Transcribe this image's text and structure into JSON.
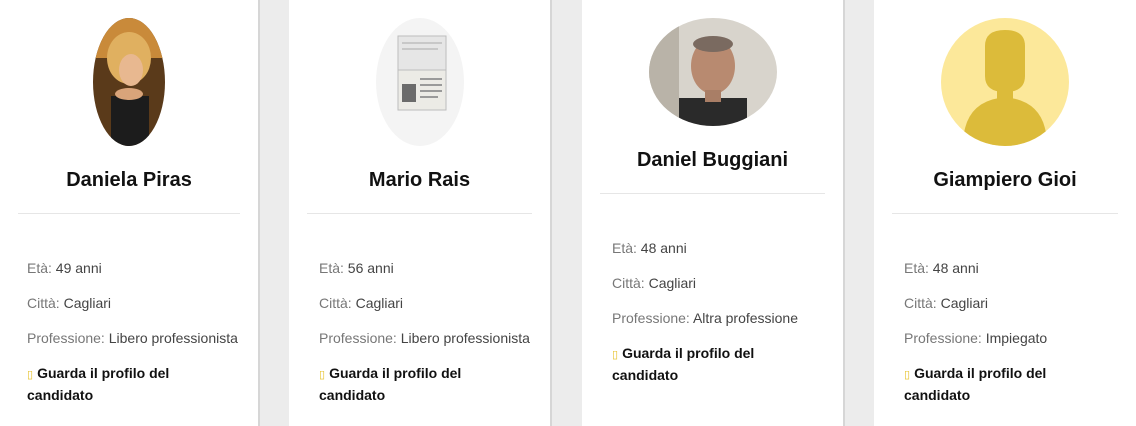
{
  "labels": {
    "age": "Età:",
    "city": "Città:",
    "profession": "Professione:",
    "link_arrow": "▯",
    "link_text": "Guarda il profilo del candidato"
  },
  "candidates": [
    {
      "name": "Daniela Piras",
      "age": "49 anni",
      "city": "Cagliari",
      "profession": "Libero professionista",
      "avatar_icon": "woman-photo"
    },
    {
      "name": "Mario Rais",
      "age": "56 anni",
      "city": "Cagliari",
      "profession": "Libero professionista",
      "avatar_icon": "passport-photo"
    },
    {
      "name": "Daniel Buggiani",
      "age": "48 anni",
      "city": "Cagliari",
      "profession": "Altra professione",
      "avatar_icon": "man-photo"
    },
    {
      "name": "Giampiero Gioi",
      "age": "48 anni",
      "city": "Cagliari",
      "profession": "Impiegato",
      "avatar_icon": "default-user-icon"
    }
  ],
  "colors": {
    "accent": "#e6c22a",
    "placeholder_bg": "#fce89a",
    "placeholder_fg": "#dcbb3a"
  }
}
